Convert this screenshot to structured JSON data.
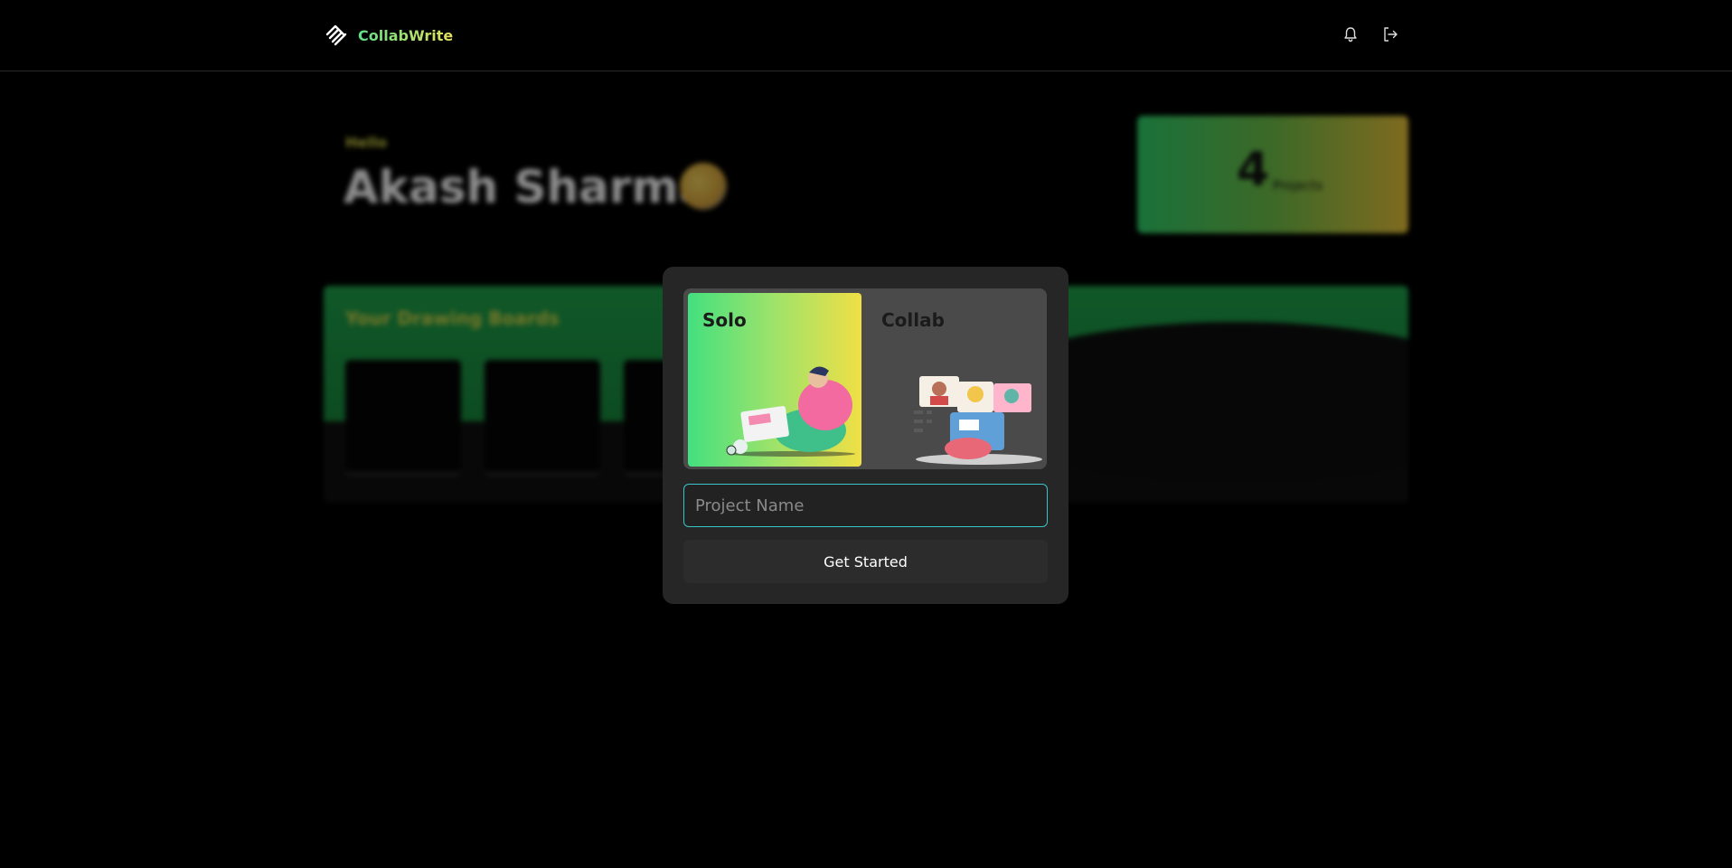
{
  "app": {
    "name": "CollabWrite"
  },
  "header": {
    "icons": [
      "bell-icon",
      "logout-icon"
    ]
  },
  "dashboard": {
    "greeting": "Hello",
    "user_name": "Akash Sharma",
    "projects_count": "4",
    "projects_label": "Projects",
    "boards_title": "Your Drawing Boards"
  },
  "modal": {
    "options": [
      {
        "label": "Solo",
        "selected": true
      },
      {
        "label": "Collab",
        "selected": false
      }
    ],
    "project_input": {
      "value": "",
      "placeholder": "Project Name"
    },
    "submit_label": "Get Started"
  },
  "colors": {
    "accent_green": "#43e07f",
    "accent_yellow": "#f0df45",
    "input_focus": "#3bc4c8",
    "modal_bg": "#262626"
  }
}
